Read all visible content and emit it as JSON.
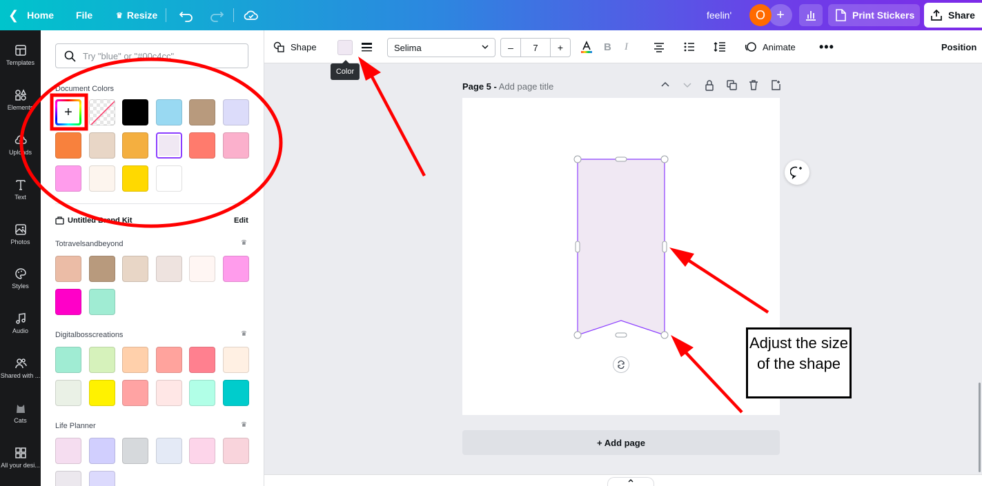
{
  "topbar": {
    "home_label": "Home",
    "file_label": "File",
    "resize_label": "Resize",
    "design_title": "feelin'",
    "avatar_initial": "O",
    "print_label": "Print Stickers",
    "share_label": "Share"
  },
  "rail": {
    "items": [
      {
        "label": "Templates",
        "icon": "templates-icon"
      },
      {
        "label": "Elements",
        "icon": "elements-icon"
      },
      {
        "label": "Uploads",
        "icon": "uploads-icon"
      },
      {
        "label": "Text",
        "icon": "text-icon"
      },
      {
        "label": "Photos",
        "icon": "photos-icon"
      },
      {
        "label": "Styles",
        "icon": "styles-icon"
      },
      {
        "label": "Audio",
        "icon": "audio-icon"
      },
      {
        "label": "Shared with ...",
        "icon": "shared-icon"
      },
      {
        "label": "Cats",
        "icon": "cats-icon"
      },
      {
        "label": "All your desi...",
        "icon": "designs-icon"
      }
    ]
  },
  "panel": {
    "search_placeholder": "Try \"blue\" or \"#00c4cc\"",
    "document_colors_title": "Document Colors",
    "document_colors": [
      "#000000",
      "#99d9f2",
      "#b89a7d",
      "#dcdcfa",
      "#f8813d",
      "#e8d6c6",
      "#f4af40",
      "#f0e8f3",
      "#ff7b6d",
      "#fbb0cc",
      "#ff9cec",
      "#fdf5ee",
      "#ffd900",
      "#ffffff"
    ],
    "selected_color": "#f0e8f3",
    "brand_kit_name": "Untitled Brand Kit",
    "edit_label": "Edit",
    "palettes": [
      {
        "name": "Totravelsandbeyond",
        "colors": [
          "#ebbca6",
          "#b89a7d",
          "#e8d6c6",
          "#eee3df",
          "#fff6f3",
          "#ff9cec",
          "#ff00c8",
          "#a0ecd3"
        ]
      },
      {
        "name": "Digitalbosscreations",
        "colors": [
          "#a0ecd3",
          "#d6f2bb",
          "#ffd0ab",
          "#ffa39d",
          "#ff808f",
          "#fff0e3",
          "#eaf1e6",
          "#fff200",
          "#ffa3a3",
          "#ffe7e6",
          "#b1ffe7",
          "#00cccc"
        ]
      },
      {
        "name": "Life Planner",
        "colors": [
          "#f5ddf0",
          "#d1cffe",
          "#d6d9dc",
          "#e4eaf6",
          "#fdd5ea",
          "#f9d4dc",
          "#ece8ee",
          "#dcdafd"
        ]
      }
    ]
  },
  "editor_toolbar": {
    "shape_label": "Shape",
    "color_value": "#f0e8f3",
    "font_name": "Selima",
    "font_size": "7",
    "minus_label": "–",
    "plus_label": "+",
    "animate_label": "Animate",
    "position_label": "Position",
    "tooltip": "Color"
  },
  "canvas": {
    "page_number_label": "Page 5 -",
    "page_title_placeholder": "Add page title",
    "add_page_label": "+ Add page",
    "shape_fill": "#f0e8f3",
    "shape_stroke": "#8b3dff"
  },
  "annotation": {
    "note_text": "Adjust the size of the shape",
    "accent": "#ff0000"
  }
}
